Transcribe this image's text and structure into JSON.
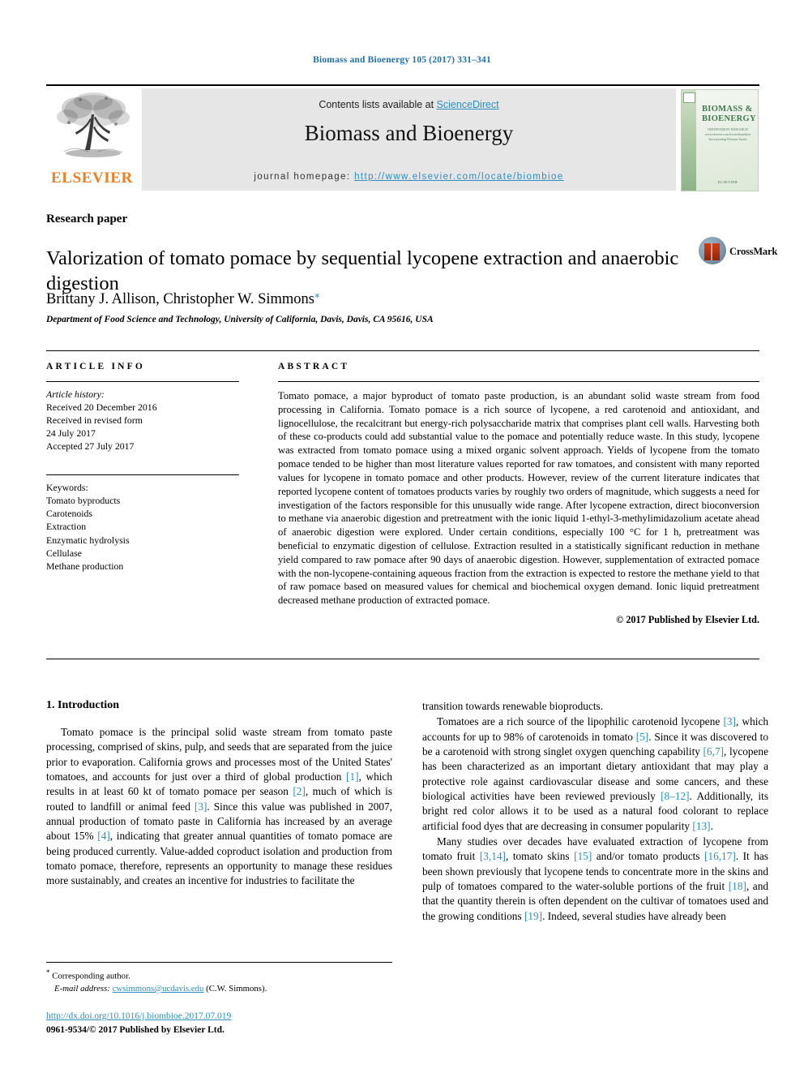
{
  "running_head": "Biomass and Bioenergy 105 (2017) 331–341",
  "masthead": {
    "contents_prefix": "Contents lists available at ",
    "sciencedirect": "ScienceDirect",
    "journal_name": "Biomass and Bioenergy",
    "homepage_prefix": "journal homepage: ",
    "homepage_url": "http://www.elsevier.com/locate/biombioe",
    "publisher_wordmark": "ELSEVIER",
    "cover": {
      "title": "BIOMASS & BIOENERGY",
      "subtitle": "INDEPENDENT RESEARCH\nwww.elsevier.com/locate/biombioe\nIncorporating Biomass Issues",
      "bottom": "ELSEVIER"
    },
    "link_color": "#2b8fc4",
    "band_color": "#e6e6e6",
    "elsevier_orange": "#ef7d22"
  },
  "article": {
    "type_label": "Research paper",
    "title": "Valorization of tomato pomace by sequential lycopene extraction and anaerobic digestion",
    "crossmark_label": "CrossMark",
    "authors": "Brittany J. Allison, Christopher W. Simmons",
    "corresponding_marker": "⁎",
    "affiliation": "Department of Food Science and Technology, University of California, Davis, Davis, CA 95616, USA"
  },
  "article_info": {
    "heading": "ARTICLE INFO",
    "history_label": "Article history:",
    "history": [
      "Received 20 December 2016",
      "Received in revised form",
      "24 July 2017",
      "Accepted 27 July 2017"
    ],
    "keywords_label": "Keywords:",
    "keywords": [
      "Tomato byproducts",
      "Carotenoids",
      "Extraction",
      "Enzymatic hydrolysis",
      "Cellulase",
      "Methane production"
    ]
  },
  "abstract": {
    "heading": "ABSTRACT",
    "body": "Tomato pomace, a major byproduct of tomato paste production, is an abundant solid waste stream from food processing in California. Tomato pomace is a rich source of lycopene, a red carotenoid and antioxidant, and lignocellulose, the recalcitrant but energy-rich polysaccharide matrix that comprises plant cell walls. Harvesting both of these co-products could add substantial value to the pomace and potentially reduce waste. In this study, lycopene was extracted from tomato pomace using a mixed organic solvent approach. Yields of lycopene from the tomato pomace tended to be higher than most literature values reported for raw tomatoes, and consistent with many reported values for lycopene in tomato pomace and other products. However, review of the current literature indicates that reported lycopene content of tomatoes products varies by roughly two orders of magnitude, which suggests a need for investigation of the factors responsible for this unusually wide range. After lycopene extraction, direct bioconversion to methane via anaerobic digestion and pretreatment with the ionic liquid 1-ethyl-3-methylimidazolium acetate ahead of anaerobic digestion were explored. Under certain conditions, especially 100 °C for 1 h, pretreatment was beneficial to enzymatic digestion of cellulose. Extraction resulted in a statistically significant reduction in methane yield compared to raw pomace after 90 days of anaerobic digestion. However, supplementation of extracted pomace with the non-lycopene-containing aqueous fraction from the extraction is expected to restore the methane yield to that of raw pomace based on measured values for chemical and biochemical oxygen demand. Ionic liquid pretreatment decreased methane production of extracted pomace.",
    "copyright": "© 2017 Published by Elsevier Ltd."
  },
  "body": {
    "section_heading": "1. Introduction",
    "left_paragraphs": [
      {
        "segments": [
          {
            "t": "Tomato pomace is the principal solid waste stream from tomato paste processing, comprised of skins, pulp, and seeds that are separated from the juice prior to evaporation. California grows and processes most of the United States' tomatoes, and accounts for just over a third of global production "
          },
          {
            "t": "[1]",
            "cite": true
          },
          {
            "t": ", which results in at least 60 kt of tomato pomace per season "
          },
          {
            "t": "[2]",
            "cite": true
          },
          {
            "t": ", much of which is routed to landfill or animal feed "
          },
          {
            "t": "[3]",
            "cite": true
          },
          {
            "t": ". Since this value was published in 2007, annual production of tomato paste in California has increased by an average about 15% "
          },
          {
            "t": "[4]",
            "cite": true
          },
          {
            "t": ", indicating that greater annual quantities of tomato pomace are being produced currently. Value-added coproduct isolation and production from tomato pomace, therefore, represents an opportunity to manage these residues more sustainably, and creates an incentive for industries to facilitate the"
          }
        ]
      }
    ],
    "right_paragraphs": [
      {
        "indent": false,
        "segments": [
          {
            "t": "transition towards renewable bioproducts."
          }
        ]
      },
      {
        "indent": true,
        "segments": [
          {
            "t": "Tomatoes are a rich source of the lipophilic carotenoid lycopene "
          },
          {
            "t": "[3]",
            "cite": true
          },
          {
            "t": ", which accounts for up to 98% of carotenoids in tomato "
          },
          {
            "t": "[5]",
            "cite": true
          },
          {
            "t": ". Since it was discovered to be a carotenoid with strong singlet oxygen quenching capability "
          },
          {
            "t": "[6,7]",
            "cite": true
          },
          {
            "t": ", lycopene has been characterized as an important dietary antioxidant that may play a protective role against cardiovascular disease and some cancers, and these biological activities have been reviewed previously "
          },
          {
            "t": "[8–12]",
            "cite": true
          },
          {
            "t": ". Additionally, its bright red color allows it to be used as a natural food colorant to replace artificial food dyes that are decreasing in consumer popularity "
          },
          {
            "t": "[13]",
            "cite": true
          },
          {
            "t": "."
          }
        ]
      },
      {
        "indent": true,
        "segments": [
          {
            "t": "Many studies over decades have evaluated extraction of lycopene from tomato fruit "
          },
          {
            "t": "[3,14]",
            "cite": true
          },
          {
            "t": ", tomato skins "
          },
          {
            "t": "[15]",
            "cite": true
          },
          {
            "t": " and/or tomato products "
          },
          {
            "t": "[16,17]",
            "cite": true
          },
          {
            "t": ". It has been shown previously that lycopene tends to concentrate more in the skins and pulp of tomatoes compared to the water-soluble portions of the fruit "
          },
          {
            "t": "[18]",
            "cite": true
          },
          {
            "t": ", and that the quantity therein is often dependent on the cultivar of tomatoes used and the growing conditions "
          },
          {
            "t": "[19]",
            "cite": true
          },
          {
            "t": ". Indeed, several studies have already been"
          }
        ]
      }
    ]
  },
  "footer": {
    "corresponding_label": "Corresponding author.",
    "email_label": "E-mail address:",
    "email": "cwsimmons@ucdavis.edu",
    "email_owner": "(C.W. Simmons).",
    "doi_url": "http://dx.doi.org/10.1016/j.biombioe.2017.07.019",
    "issn_line": "0961-9534/© 2017 Published by Elsevier Ltd."
  }
}
